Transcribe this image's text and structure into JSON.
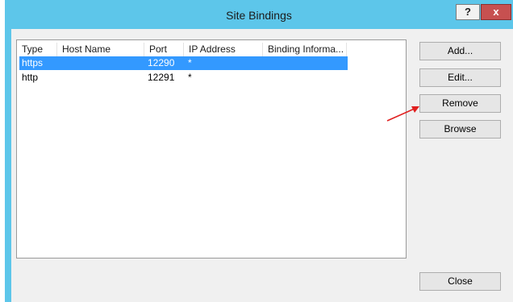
{
  "window": {
    "title": "Site Bindings",
    "help_label": "?",
    "close_label": "x"
  },
  "list": {
    "columns": [
      "Type",
      "Host Name",
      "Port",
      "IP Address",
      "Binding Informa..."
    ],
    "rows": [
      {
        "type": "https",
        "host": "",
        "port": "12290",
        "ip": "*",
        "binding": "",
        "selected": true
      },
      {
        "type": "http",
        "host": "",
        "port": "12291",
        "ip": "*",
        "binding": "",
        "selected": false
      }
    ]
  },
  "buttons": {
    "add": "Add...",
    "edit": "Edit...",
    "remove": "Remove",
    "browse": "Browse",
    "close": "Close"
  },
  "colors": {
    "title_bar": "#5dc6ea",
    "selection": "#3399ff",
    "close_button": "#c75050",
    "annotation_arrow": "#e02020"
  },
  "annotation": {
    "icon": "red-arrow-icon",
    "target": "remove-button"
  }
}
